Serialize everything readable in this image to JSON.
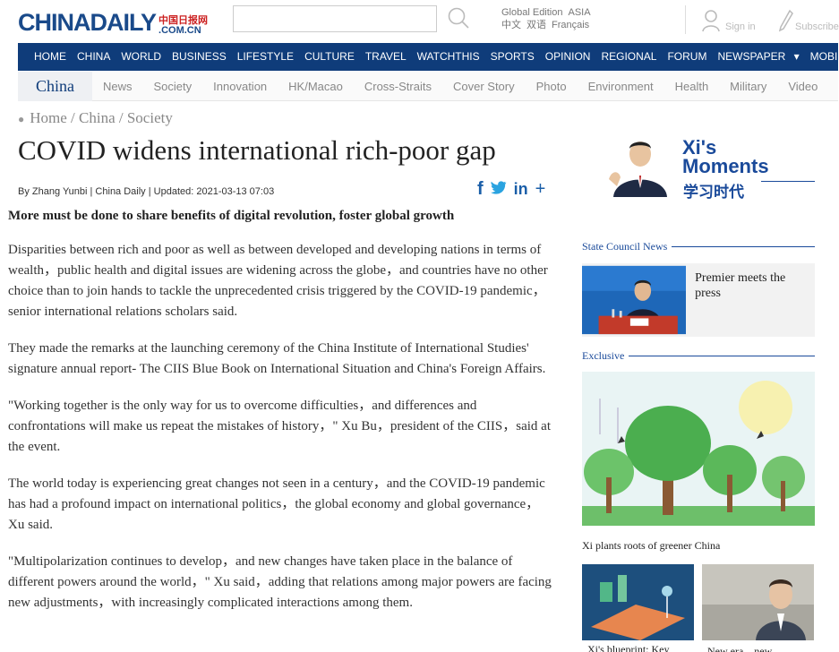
{
  "header": {
    "logo_main": "CHINADAILY",
    "logo_cn": "中国日报网",
    "logo_com": ".COM.CN",
    "edition_label": "Global Edition",
    "edition_region": "ASIA",
    "lang_zh": "中文",
    "lang_bilingual": "双语",
    "lang_fr": "Français",
    "signin": "Sign in",
    "subscribe": "Subscribe"
  },
  "nav": {
    "items": [
      "HOME",
      "CHINA",
      "WORLD",
      "BUSINESS",
      "LIFESTYLE",
      "CULTURE",
      "TRAVEL",
      "WATCHTHIS",
      "SPORTS",
      "OPINION",
      "REGIONAL",
      "FORUM",
      "NEWSPAPER"
    ],
    "newspaper_caret": "▾",
    "mobile": "MOBILE"
  },
  "subnav": {
    "home": "China",
    "items": [
      "News",
      "Society",
      "Innovation",
      "HK/Macao",
      "Cross-Straits",
      "Cover Story",
      "Photo",
      "Environment",
      "Health",
      "Military",
      "Video"
    ]
  },
  "breadcrumb": "Home / China / Society",
  "article": {
    "title": "COVID widens international rich-poor gap",
    "byline": "By Zhang Yunbi | China Daily | Updated: 2021-03-13 07:03",
    "lead": "More must be done to share benefits of digital revolution, foster global growth",
    "paragraphs": [
      "Disparities between rich and poor as well as between developed and developing nations in terms of wealth，public health and digital issues are widening across the globe，and countries have no other choice than to join hands to tackle the unprecedented crisis triggered by the COVID-19 pandemic，senior international relations scholars said.",
      "They made the remarks at the launching ceremony of the China Institute of International Studies' signature annual report-   The CIIS Blue Book on International Situation and China's Foreign Affairs.",
      "\"Working together is the only way for us to overcome difficulties，and differences and confrontations will make us repeat the mistakes of history，\" Xu Bu，president of the CIIS，said at the event.",
      "The world today is experiencing great changes not seen in a century，and the COVID-19 pandemic has had a profound impact on international politics，the global economy and global governance，Xu said.",
      "\"Multipolarization continues to develop，and new changes have taken place in the balance of different powers around the world，\" Xu said，adding that relations among major powers are facing new adjustments，with increasingly complicated interactions among them."
    ]
  },
  "share": {
    "facebook": "f",
    "twitter": "twitter-icon",
    "linkedin": "in",
    "more": "+"
  },
  "sidebar": {
    "xi_title_1": "Xi's",
    "xi_title_2": "Moments",
    "xi_cn": "学习时代",
    "state_council_head": "State Council News",
    "state_council_item": "Premier meets the press",
    "exclusive_head": "Exclusive",
    "exclusive_caption": "Xi plants roots of greener China",
    "thumb1_caption": "Xi's blueprint: Key",
    "thumb2_caption": "New era，new"
  },
  "colors": {
    "brand_blue": "#0f3c7a",
    "link_blue": "#1a4a9a"
  }
}
